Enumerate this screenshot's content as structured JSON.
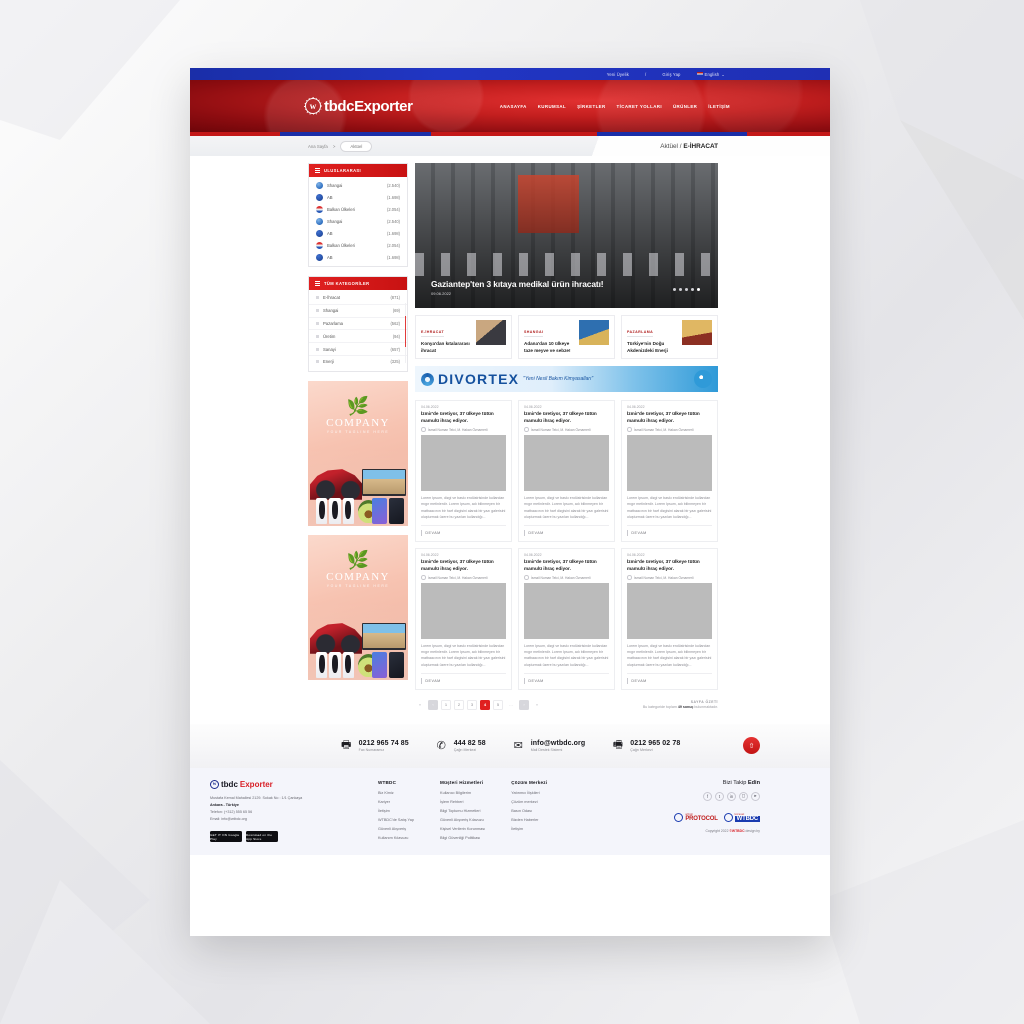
{
  "topbar": {
    "register": "Yeni Üyelik",
    "separator": "/",
    "login": "Giriş Yap",
    "language": "English",
    "lang_caret": "⌄"
  },
  "header": {
    "logo_mark": "w",
    "logo_text": "tbdcExporter",
    "nav": [
      {
        "label": "ANASAYFA"
      },
      {
        "label": "KURUMSAL"
      },
      {
        "label": "ŞİRKETLER"
      },
      {
        "label": "TİCARET YOLLARI"
      },
      {
        "label": "ÜRÜNLER"
      },
      {
        "label": "İLETİŞİM"
      }
    ]
  },
  "breadcrumb": {
    "home": "Ana Sayfa",
    "chevron": ">",
    "current": "Aktüel",
    "right_prefix": "Aktüel",
    "right_sep": "/",
    "right_section": "E-İHRACAT"
  },
  "sidebar": {
    "international": {
      "title": "ULUSLARARASI",
      "items": [
        {
          "label": "Shangai",
          "count": "(2.540)",
          "icon": "globe-icon"
        },
        {
          "label": "AB",
          "count": "(1.698)",
          "icon": "globe-dark-icon"
        },
        {
          "label": "Balkan Ülkeleri",
          "count": "(2.054)",
          "icon": "flag-icon"
        },
        {
          "label": "Shangai",
          "count": "(2.540)",
          "icon": "globe-icon"
        },
        {
          "label": "AB",
          "count": "(1.698)",
          "icon": "globe-dark-icon"
        },
        {
          "label": "Balkan Ülkeleri",
          "count": "(2.054)",
          "icon": "flag-icon"
        },
        {
          "label": "AB",
          "count": "(1.698)",
          "icon": "globe-dark-icon"
        }
      ]
    },
    "categories": {
      "title": "TÜM KATEGORİLER",
      "items": [
        {
          "label": "E-İhracat",
          "count": "(871)"
        },
        {
          "label": "Shangai",
          "count": "(69)"
        },
        {
          "label": "Pazarlama",
          "count": "(562)"
        },
        {
          "label": "Üretim",
          "count": "(94)"
        },
        {
          "label": "Sanayi",
          "count": "(657)"
        },
        {
          "label": "Enerji",
          "count": "(325)"
        }
      ]
    },
    "ads": [
      {
        "name": "COMPANY",
        "tagline": "YOUR TAGLINE HERE"
      },
      {
        "name": "COMPANY",
        "tagline": "YOUR TAGLINE HERE"
      }
    ]
  },
  "hero": {
    "title": "Gaziantep'ten 3 kıtaya medikal ürün ihracatı!",
    "date": "09.06.2022",
    "dots": 5,
    "active_dot": 5
  },
  "features": [
    {
      "kicker": "E-İHRACAT",
      "title": "Konya'dan kıtalararası ihracat"
    },
    {
      "kicker": "SHANGAI",
      "title": "Adana'dan 10 ülkeye taze meyve ve sebze!"
    },
    {
      "kicker": "PAZARLAMA",
      "title": "Türkiye'nin Doğu Akdenizdeki Enerji"
    }
  ],
  "banner": {
    "brand": "DIVORTEX",
    "slogan": "\"Yeni Nesil Bakım Kimyasalları\""
  },
  "news": {
    "read_more": "DEVAM",
    "items": [
      {
        "date": "04.06.2022",
        "title": "İzmir'de üretiyor, 37 ülkeye tütün mamulü ihraç ediyor.",
        "author": "İsmail Numan Telci, M. Hakan Öznamerli",
        "excerpt": "Lorem Ipsum, dizgi ve baskı endüstrisinde kullanılan mıgır metinlerdir. Lorem Ipsum, adı bilinmeyen bir matbaacının bir harf dizgisini alarak bir yazı galerisini oluşturmak üzere bu yazıları kullandığı..."
      },
      {
        "date": "04.06.2022",
        "title": "İzmir'de üretiyor, 37 ülkeye tütün mamulü ihraç ediyor.",
        "author": "İsmail Numan Telci, M. Hakan Öznamerli",
        "excerpt": "Lorem Ipsum, dizgi ve baskı endüstrisinde kullanılan mıgır metinlerdir. Lorem Ipsum, adı bilinmeyen bir matbaacının bir harf dizgisini alarak bir yazı galerisini oluşturmak üzere bu yazıları kullandığı..."
      },
      {
        "date": "04.06.2022",
        "title": "İzmir'de üretiyor, 37 ülkeye tütün mamulü ihraç ediyor.",
        "author": "İsmail Numan Telci, M. Hakan Öznamerli",
        "excerpt": "Lorem Ipsum, dizgi ve baskı endüstrisinde kullanılan mıgır metinlerdir. Lorem Ipsum, adı bilinmeyen bir matbaacının bir harf dizgisini alarak bir yazı galerisini oluşturmak üzere bu yazıları kullandığı..."
      },
      {
        "date": "04.06.2022",
        "title": "İzmir'de üretiyor, 37 ülkeye tütün mamulü ihraç ediyor.",
        "author": "İsmail Numan Telci, M. Hakan Öznamerli",
        "excerpt": "Lorem Ipsum, dizgi ve baskı endüstrisinde kullanılan mıgır metinlerdir. Lorem Ipsum, adı bilinmeyen bir matbaacının bir harf dizgisini alarak bir yazı galerisini oluşturmak üzere bu yazıları kullandığı..."
      },
      {
        "date": "04.06.2022",
        "title": "İzmir'de üretiyor, 37 ülkeye tütün mamulü ihraç ediyor.",
        "author": "İsmail Numan Telci, M. Hakan Öznamerli",
        "excerpt": "Lorem Ipsum, dizgi ve baskı endüstrisinde kullanılan mıgır metinlerdir. Lorem Ipsum, adı bilinmeyen bir matbaacının bir harf dizgisini alarak bir yazı galerisini oluşturmak üzere bu yazıları kullandığı..."
      },
      {
        "date": "04.06.2022",
        "title": "İzmir'de üretiyor, 37 ülkeye tütün mamulü ihraç ediyor.",
        "author": "İsmail Numan Telci, M. Hakan Öznamerli",
        "excerpt": "Lorem Ipsum, dizgi ve baskı endüstrisinde kullanılan mıgır metinlerdir. Lorem Ipsum, adı bilinmeyen bir matbaacının bir harf dizgisini alarak bir yazı galerisini oluşturmak üzere bu yazıları kullandığı..."
      }
    ]
  },
  "pagination": {
    "first": "«",
    "prev": "‹",
    "pages": [
      "1",
      "2",
      "3",
      "4",
      "5"
    ],
    "active": "4",
    "ellipsis": "…",
    "next": "›",
    "last": "»",
    "summary_title": "SAYFA ÖZETİ",
    "summary_pre": "Bu kategoride toplam",
    "summary_count": "49 sonuç",
    "summary_post": "bulunmaktadır."
  },
  "contact": [
    {
      "icon": "printer-icon",
      "glyph": "🖶",
      "value": "0212 965 74 85",
      "label": "Fax Numaramız"
    },
    {
      "icon": "phone-icon",
      "glyph": "✆",
      "value": "444 82 58",
      "label": "Çağrı Merkezi"
    },
    {
      "icon": "mail-icon",
      "glyph": "✉",
      "value": "info@wtbdc.org",
      "label": "Mail Destek Sistemi"
    },
    {
      "icon": "fax-icon",
      "glyph": "🖷",
      "value": "0212 965 02 78",
      "label": "Çağrı Merkezi"
    }
  ],
  "scroll_top": {
    "icon": "arrow-up-icon",
    "glyph": "⇧"
  },
  "footer": {
    "logo_mark": "w",
    "logo_text_1": "tbdc",
    "logo_text_2": "Exporter",
    "address_line1": "Mustafa Kemal Mahallesi 2129. Sokak No : 1/1 Çankaya",
    "address_line2": "Ankara - Türkiye",
    "phone": "Telefon: (+312) 555 65 56",
    "email": "Email: info@wtbdc.org",
    "stores": [
      {
        "label": "GET IT ON Google Play"
      },
      {
        "label": "Download on the App Store"
      }
    ],
    "columns": [
      {
        "title": "WTBDC",
        "links": [
          "Biz Kimiz",
          "Kariyer",
          "İletişim",
          "WTBDC'de Satış Yap",
          "Güvenli Alışveriş",
          "Kullanım Kılavuzu"
        ]
      },
      {
        "title": "Müşteri Hizmetleri",
        "links": [
          "Kullanıcı Bilgilerim",
          "İşlem Rehberi",
          "Bilgi Toplumu Hizmetleri",
          "Güvenli Alışveriş Kılavuzu",
          "Kişisel Verilerin Korunması",
          "Bilgi Güvenliği Politikası"
        ]
      },
      {
        "title": "Çözüm Merkezi",
        "links": [
          "Yatırımcı İlişkileri",
          "Çözüm merkezi",
          "Basın Odası",
          "Bizden Haberler",
          "İletişim"
        ]
      }
    ],
    "follow_title_normal": "Bizi Takip ",
    "follow_title_bold": "Edin",
    "socials": [
      {
        "name": "facebook-icon",
        "glyph": "f"
      },
      {
        "name": "twitter-icon",
        "glyph": "t"
      },
      {
        "name": "linkedin-icon",
        "glyph": "in"
      },
      {
        "name": "instagram-icon",
        "glyph": "◻"
      },
      {
        "name": "youtube-icon",
        "glyph": "▸"
      }
    ],
    "partner_logos": [
      {
        "top": "wtbdc",
        "main": "PROTOCOL"
      },
      {
        "top": "küresel",
        "main": "WTBDC"
      }
    ],
    "copyright_pre": "Copyright 2022 ",
    "copyright_brand": "©WTBDC",
    "copyright_post": " design by"
  },
  "colors": {
    "brand_red": "#e02020",
    "brand_blue": "#1a2ea8",
    "accent_dark_red": "#8c0c10"
  }
}
